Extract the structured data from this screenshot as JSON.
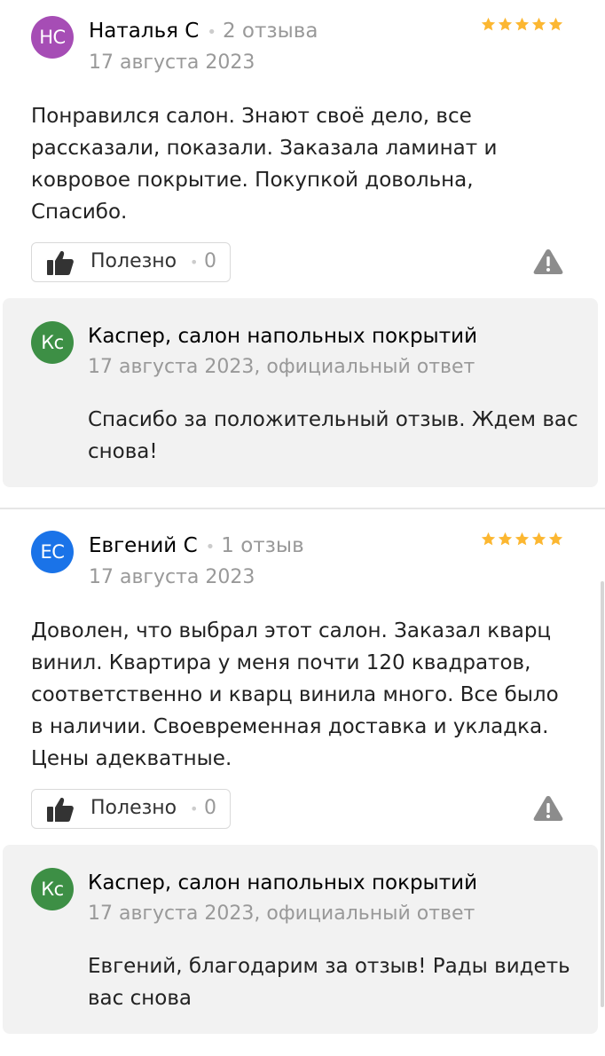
{
  "reviews": [
    {
      "avatar_initials": "НС",
      "avatar_color": "#a64db5",
      "author": "Наталья С",
      "reviews_count": "2 отзыва",
      "date": "17 августа 2023",
      "rating": 5,
      "text": "Понравился салон. Знают своё дело, все рассказали, показали. Заказала ламинат и ковровое покрытие. Покупкой довольна, Спасибо.",
      "helpful_label": "Полезно",
      "helpful_count": "0",
      "reply": {
        "avatar_initials": "Кс",
        "author": "Каспер, салон напольных покрытий",
        "date": "17 августа 2023, официальный ответ",
        "text": "Спасибо за положительный отзыв. Ждем вас снова!"
      }
    },
    {
      "avatar_initials": "ЕС",
      "avatar_color": "#1a73e8",
      "author": "Евгений С",
      "reviews_count": "1 отзыв",
      "date": "17 августа 2023",
      "rating": 5,
      "text": "Доволен, что выбрал этот салон. Заказал кварц винил. Квартира у меня почти 120 квадратов, соответственно и кварц винила много. Все было в наличии. Своевременная доставка и укладка. Цены адекватные.",
      "helpful_label": "Полезно",
      "helpful_count": "0",
      "reply": {
        "avatar_initials": "Кс",
        "author": "Каспер, салон напольных покрытий",
        "date": "17 августа 2023, официальный ответ",
        "text": "Евгений, благодарим за отзыв! Рады видеть вас снова"
      }
    }
  ],
  "star_color": "#fcb731"
}
